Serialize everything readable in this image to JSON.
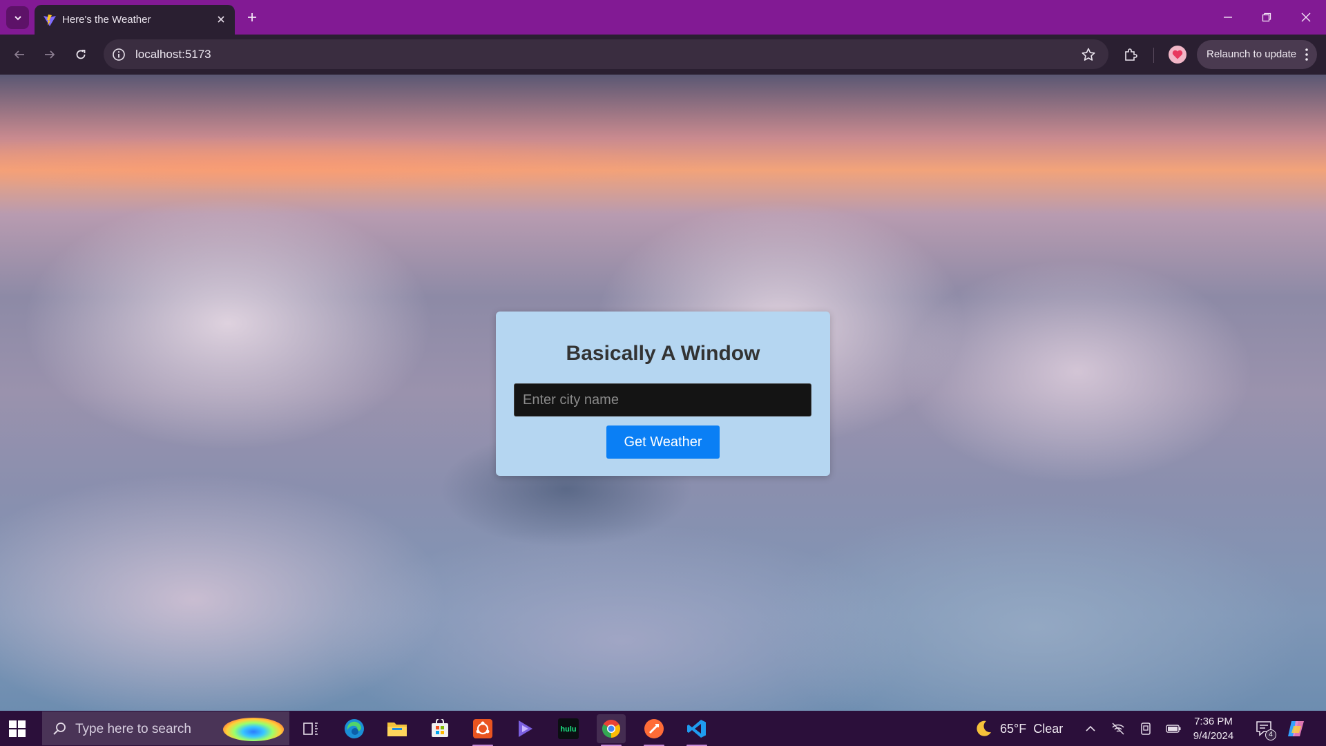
{
  "browser": {
    "tab_title": "Here's the Weather",
    "url": "localhost:5173",
    "relaunch_label": "Relaunch to update",
    "accent_color": "#821a94"
  },
  "app": {
    "heading": "Basically A Window",
    "city_input": {
      "placeholder": "Enter city name",
      "value": ""
    },
    "submit_label": "Get Weather",
    "card_color": "#b5d6f1",
    "button_color": "#0a7ff5"
  },
  "taskbar": {
    "search_placeholder": "Type here to search",
    "apps": [
      "task-view",
      "edge",
      "file-explorer",
      "microsoft-store",
      "ubuntu",
      "clipchamp",
      "hulu",
      "chrome",
      "postman",
      "vscode"
    ],
    "hulu_label": "hulu",
    "weather": {
      "temp": "65°F",
      "condition": "Clear"
    },
    "clock": {
      "time": "7:36 PM",
      "date": "9/4/2024"
    },
    "notification_count": "4"
  }
}
